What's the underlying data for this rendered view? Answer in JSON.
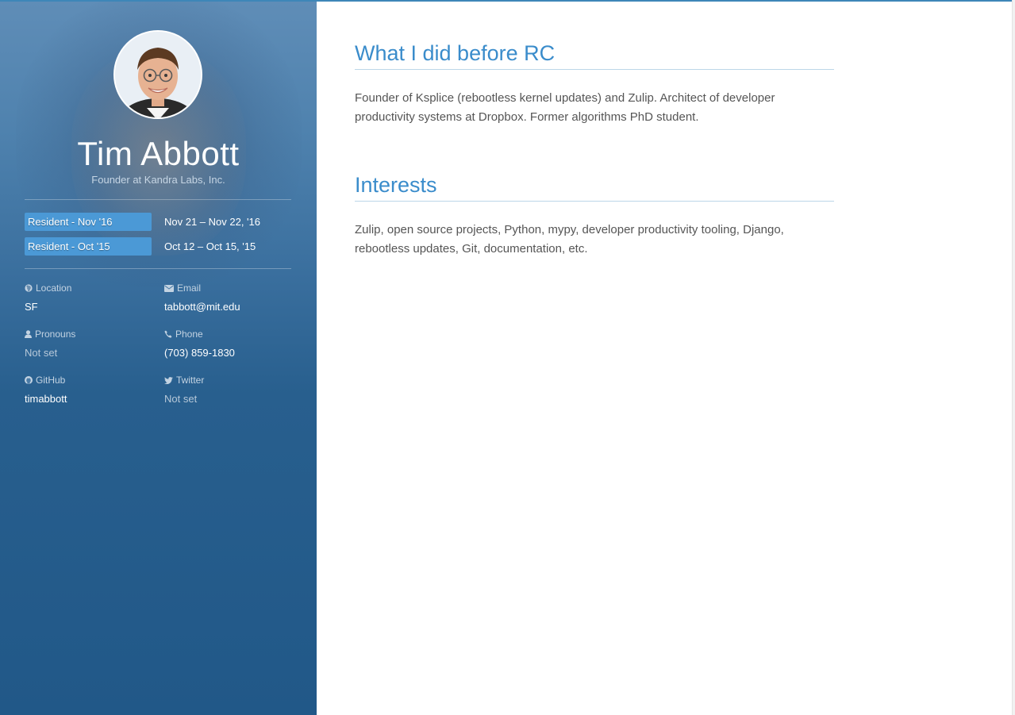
{
  "profile": {
    "name": "Tim Abbott",
    "tagline": "Founder at Kandra Labs, Inc."
  },
  "residencies": [
    {
      "label": "Resident - Nov '16",
      "dates": "Nov 21 – Nov 22, '16"
    },
    {
      "label": "Resident - Oct '15",
      "dates": "Oct 12 – Oct 15, '15"
    }
  ],
  "info": {
    "location": {
      "label": "Location",
      "value": "SF",
      "icon": "globe-icon"
    },
    "email": {
      "label": "Email",
      "value": "tabbott@mit.edu",
      "icon": "envelope-icon"
    },
    "pronouns": {
      "label": "Pronouns",
      "value": "Not set",
      "icon": "user-icon"
    },
    "phone": {
      "label": "Phone",
      "value": "(703) 859-1830",
      "icon": "phone-icon"
    },
    "github": {
      "label": "GitHub",
      "value": "timabbott",
      "icon": "github-icon"
    },
    "twitter": {
      "label": "Twitter",
      "value": "Not set",
      "icon": "twitter-icon"
    }
  },
  "sections": [
    {
      "heading": "What I did before RC",
      "body": "Founder of Ksplice (rebootless kernel updates) and Zulip. Architect of developer productivity systems at Dropbox. Former algorithms PhD student."
    },
    {
      "heading": "Interests",
      "body": "Zulip, open source projects, Python, mypy, developer productivity tooling, Django, rebootless updates, Git, documentation, etc."
    }
  ],
  "colors": {
    "accent": "#3a8ccb",
    "badge": "#4b99d6",
    "sidebar": "#215888"
  }
}
